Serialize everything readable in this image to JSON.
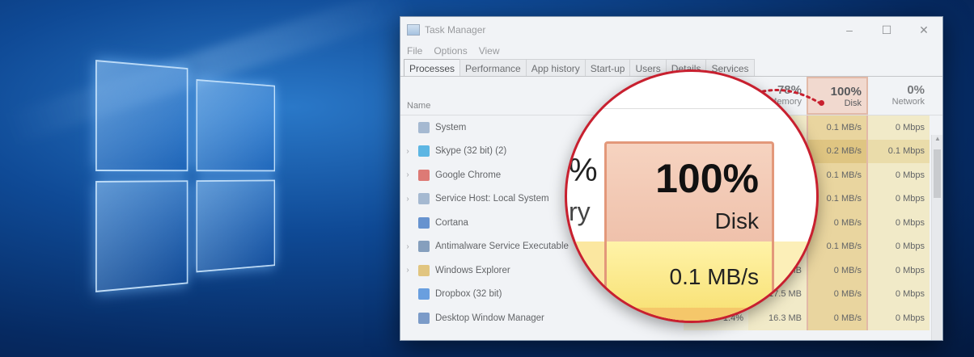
{
  "window": {
    "title": "Task Manager",
    "controls": {
      "minimize": "–",
      "maximize": "☐",
      "close": "✕"
    }
  },
  "menu": [
    "File",
    "Options",
    "View"
  ],
  "tabs": [
    "Processes",
    "Performance",
    "App history",
    "Start-up",
    "Users",
    "Details",
    "Services"
  ],
  "active_tab": "Processes",
  "columns": {
    "name": "Name",
    "memory": {
      "pct": "78%",
      "label": "Memory"
    },
    "disk": {
      "pct": "100%",
      "label": "Disk"
    },
    "network": {
      "pct": "0%",
      "label": "Network"
    }
  },
  "processes": [
    {
      "name": "System",
      "expandable": false,
      "icon_color": "#8aa7c7",
      "cpu": "",
      "mem": "",
      "disk": "0.1 MB/s",
      "net": "0 Mbps",
      "hot": false
    },
    {
      "name": "Skype (32 bit) (2)",
      "expandable": true,
      "icon_color": "#1da1e2",
      "cpu": "",
      "mem": "",
      "disk": "0.2 MB/s",
      "net": "0.1 Mbps",
      "hot": true
    },
    {
      "name": "Google Chrome",
      "expandable": true,
      "icon_color": "#e0453a",
      "cpu": "",
      "mem": "",
      "disk": "0.1 MB/s",
      "net": "0 Mbps",
      "hot": false
    },
    {
      "name": "Service Host: Local System",
      "expandable": true,
      "icon_color": "#8aa7c7",
      "cpu": "",
      "mem": "",
      "disk": "0.1 MB/s",
      "net": "0 Mbps",
      "hot": false
    },
    {
      "name": "Cortana",
      "expandable": false,
      "icon_color": "#2b6cc4",
      "cpu": "",
      "mem": "",
      "disk": "0 MB/s",
      "net": "0 Mbps",
      "hot": false
    },
    {
      "name": "Antimalware Service Executable",
      "expandable": true,
      "icon_color": "#5a7fa8",
      "cpu": "",
      "mem": "",
      "disk": "0.1 MB/s",
      "net": "0 Mbps",
      "hot": false
    },
    {
      "name": "Windows Explorer",
      "expandable": true,
      "icon_color": "#e6b84a",
      "cpu": "",
      "mem": "MB",
      "disk": "0 MB/s",
      "net": "0 Mbps",
      "hot": false
    },
    {
      "name": "Dropbox (32 bit)",
      "expandable": false,
      "icon_color": "#2f7fdc",
      "cpu": "",
      "mem": "17.5 MB",
      "disk": "0 MB/s",
      "net": "0 Mbps",
      "hot": false
    },
    {
      "name": "Desktop Window Manager",
      "expandable": false,
      "icon_color": "#4a78b8",
      "cpu": "1.4%",
      "mem": "16.3 MB",
      "disk": "0 MB/s",
      "net": "0 Mbps",
      "hot": false
    }
  ],
  "magnifier": {
    "pct": "100%",
    "label": "Disk",
    "value": "0.1 MB/s",
    "left_fragment_1": "%",
    "left_fragment_2": "ry"
  },
  "colors": {
    "accent": "#c8202f",
    "disk_header": "#ffd8c4",
    "disk_cell": "#f3d27a"
  }
}
